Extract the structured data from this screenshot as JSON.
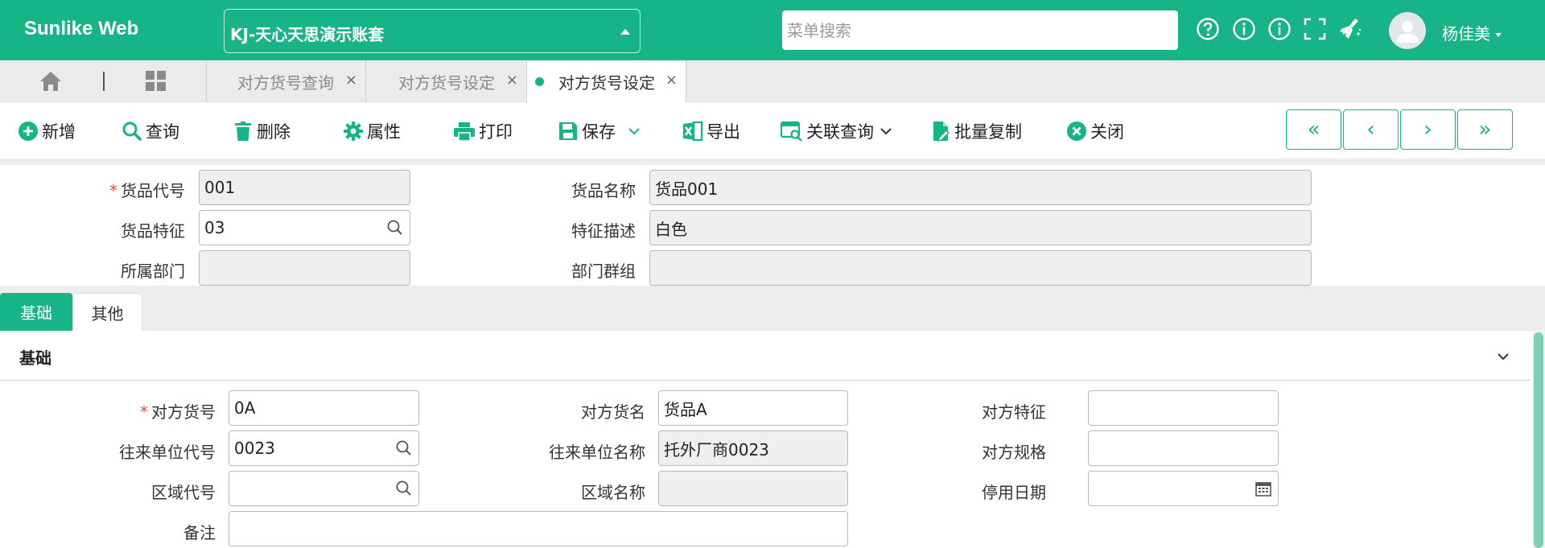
{
  "app": {
    "brand": "Sunlike Web",
    "account": "KJ-天心天思演示账套",
    "search_placeholder": "菜单搜索",
    "user": "杨佳美",
    "accent": "#16b487"
  },
  "page_tabs": [
    {
      "label": "对方货号查询",
      "active": false
    },
    {
      "label": "对方货号设定",
      "active": false
    },
    {
      "label": "对方货号设定",
      "active": true
    }
  ],
  "toolbar": {
    "new": "新增",
    "query": "查询",
    "delete": "删除",
    "properties": "属性",
    "print": "打印",
    "save": "保存",
    "export": "导出",
    "related_query": "关联查询",
    "batch_copy": "批量复制",
    "close": "关闭",
    "nav_first": "«",
    "nav_prev": "‹",
    "nav_next": "›",
    "nav_last": "»"
  },
  "header_form": {
    "item_code_label": "货品代号",
    "item_code_value": "001",
    "item_name_label": "货品名称",
    "item_name_value": "货品001",
    "feature_label": "货品特征",
    "feature_value": "03",
    "feature_desc_label": "特征描述",
    "feature_desc_value": "白色",
    "dept_label": "所属部门",
    "dept_value": "",
    "dept_group_label": "部门群组",
    "dept_group_value": ""
  },
  "sub_tabs": [
    {
      "label": "基础",
      "active": true
    },
    {
      "label": "其他",
      "active": false
    }
  ],
  "section": {
    "title": "基础",
    "cust_item_no_label": "对方货号",
    "cust_item_no_value": "0A",
    "cust_item_name_label": "对方货名",
    "cust_item_name_value": "货品A",
    "cust_feature_label": "对方特征",
    "cust_feature_value": "",
    "partner_code_label": "往来单位代号",
    "partner_code_value": "0023",
    "partner_name_label": "往来单位名称",
    "partner_name_value": "托外厂商0023",
    "cust_spec_label": "对方规格",
    "cust_spec_value": "",
    "region_code_label": "区域代号",
    "region_code_value": "",
    "region_name_label": "区域名称",
    "region_name_value": "",
    "disable_date_label": "停用日期",
    "disable_date_value": "",
    "remark_label": "备注",
    "remark_value": ""
  }
}
